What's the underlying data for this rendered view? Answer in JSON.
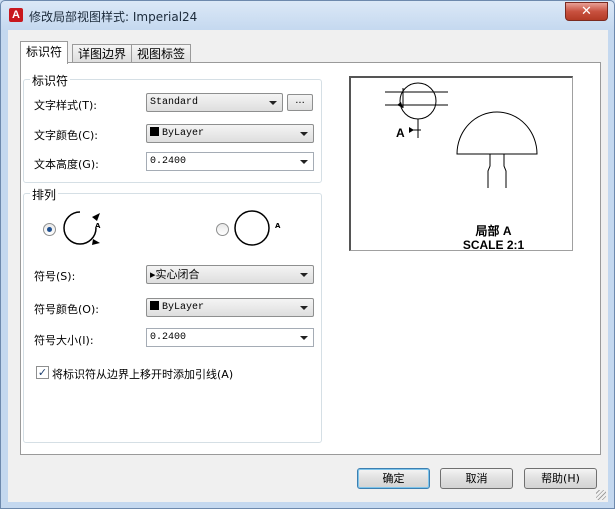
{
  "window": {
    "title": "修改局部视图样式: Imperial24",
    "app_icon_letter": "A",
    "close_glyph": "✕"
  },
  "tabs": [
    {
      "label": "标识符",
      "active": true
    },
    {
      "label": "详图边界",
      "active": false
    },
    {
      "label": "视图标签",
      "active": false
    }
  ],
  "identifier_group": {
    "title": "标识符",
    "text_style": {
      "label": "文字样式(T):",
      "value": "Standard",
      "ellipsis": "..."
    },
    "text_color": {
      "label": "文字颜色(C):",
      "value": "ByLayer"
    },
    "text_height": {
      "label": "文本高度(G):",
      "value": "0.2400"
    }
  },
  "arrangement_group": {
    "title": "排列",
    "option_a_letter": "A",
    "option_b_letter": "A",
    "selected_option": "first",
    "symbol": {
      "label": "符号(S):",
      "value": "实心闭合",
      "arrow_glyph": "▸"
    },
    "symbol_color": {
      "label": "符号颜色(O):",
      "value": "ByLayer"
    },
    "symbol_size": {
      "label": "符号大小(I):",
      "value": "0.2400"
    },
    "leader_checkbox": {
      "label": "将标识符从边界上移开时添加引线(A)",
      "checked": true,
      "check_glyph": "✓"
    }
  },
  "preview": {
    "callout_letter": "A",
    "label_line1": "局部  A",
    "label_line2": "SCALE 2:1"
  },
  "buttons": {
    "ok": "确定",
    "cancel": "取消",
    "help": "帮助(H)"
  }
}
